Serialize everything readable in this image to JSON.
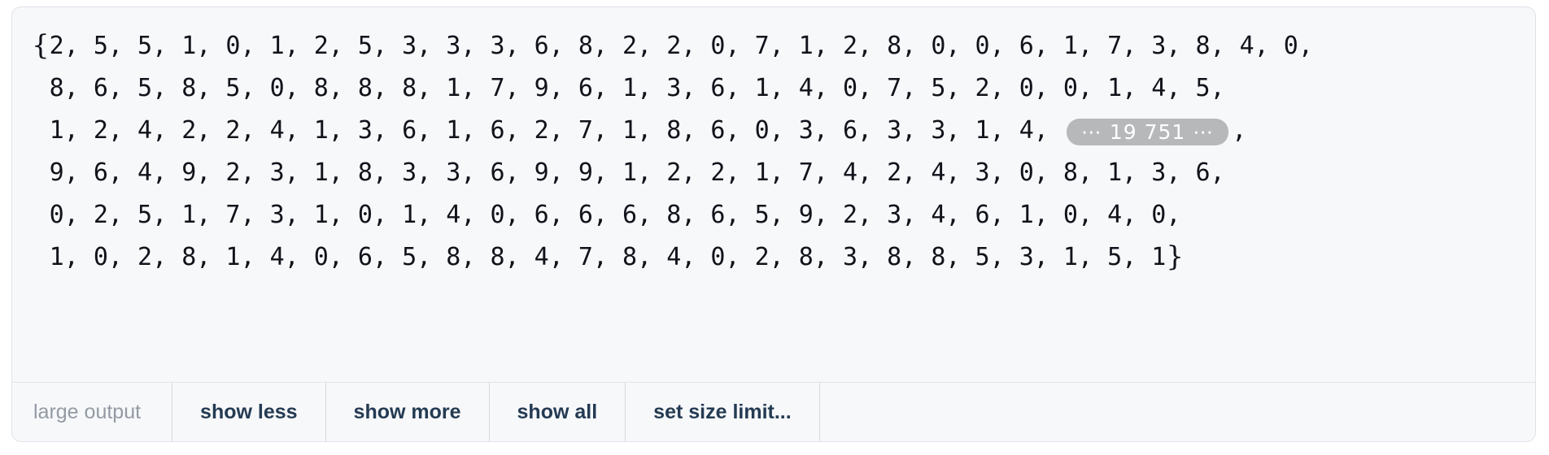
{
  "cell": {
    "open_brace": "{",
    "close_brace": "}",
    "lines": [
      {
        "text": "2, 5, 5, 1, 0, 1, 2, 5, 3, 3, 3, 6, 8, 2, 2, 0, 7, 1, 2, 8, 0, 0, 6, 1, 7, 3, 8, 4, 0,"
      },
      {
        "text": "8, 6, 5, 8, 5, 0, 8, 8, 8, 1, 7, 9, 6, 1, 3, 6, 1, 4, 0, 7, 5, 2, 0, 0, 1, 4, 5,"
      },
      {
        "text_before": "1, 2, 4, 2, 2, 4, 1, 3, 6, 1, 6, 2, 7, 1, 8, 6, 0, 3, 6, 3, 3, 1, 4, ",
        "badge": "⋯ 19 751 ⋯",
        "text_after": ","
      },
      {
        "text": "9, 6, 4, 9, 2, 3, 1, 8, 3, 3, 6, 9, 9, 1, 2, 2, 1, 7, 4, 2, 4, 3, 0, 8, 1, 3, 6,"
      },
      {
        "text": "0, 2, 5, 1, 7, 3, 1, 0, 1, 4, 0, 6, 6, 6, 8, 6, 5, 9, 2, 3, 4, 6, 1, 0, 4, 0,"
      },
      {
        "text": "1, 0, 2, 8, 1, 4, 0, 6, 5, 8, 8, 4, 7, 8, 4, 0, 2, 8, 3, 8, 8, 5, 3, 1, 5, 1"
      }
    ],
    "skipped_count": "19 751"
  },
  "action_bar": {
    "status_label": "large output",
    "actions": [
      {
        "label": "show less"
      },
      {
        "label": "show more"
      },
      {
        "label": "show all"
      },
      {
        "label": "set size limit..."
      }
    ]
  },
  "colors": {
    "cell_background": "#f7f8fa",
    "cell_border": "#dfe2e7",
    "text": "#10131a",
    "badge_background": "#b6b8ba",
    "badge_text": "#ffffff",
    "action_text": "#243b53",
    "status_text": "#939aa3",
    "divider": "#d6dade"
  }
}
